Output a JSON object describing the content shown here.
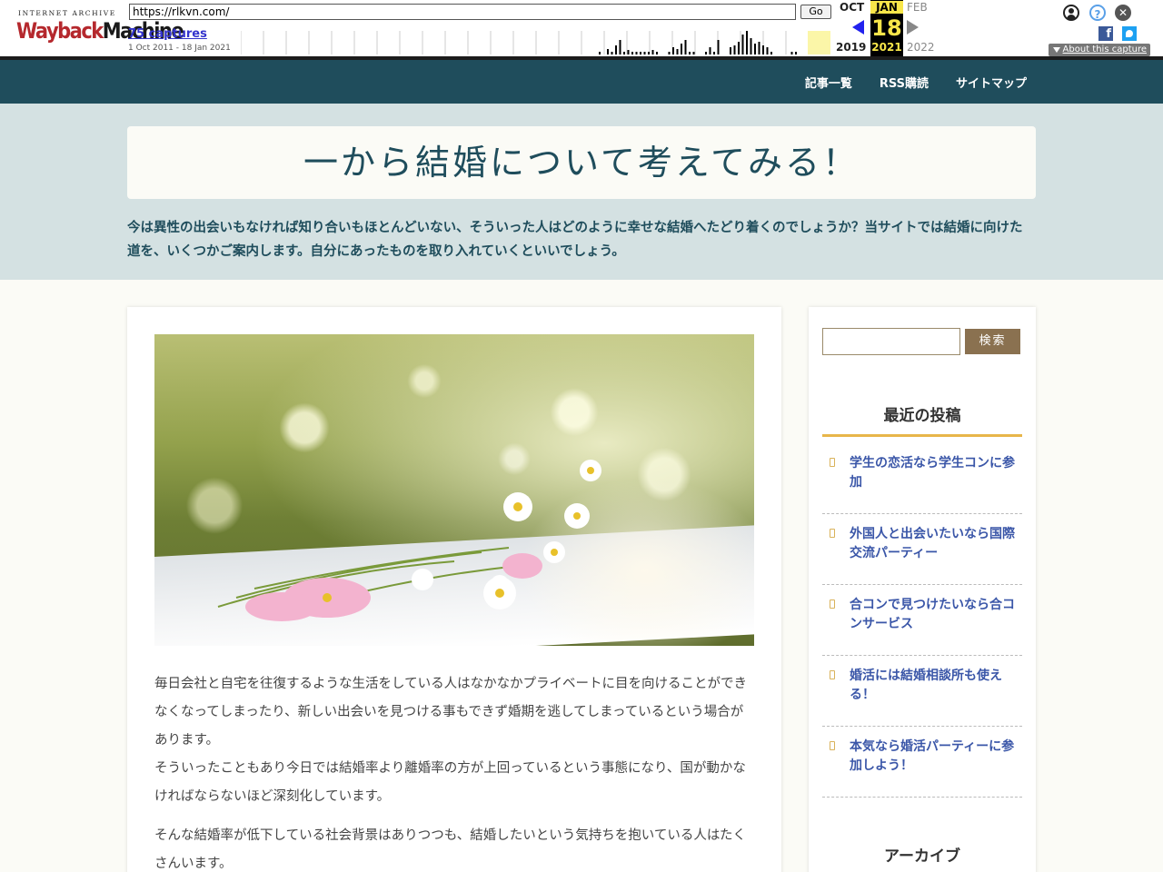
{
  "wayback": {
    "logo_top": "INTERNET ARCHIVE",
    "logo_main_a": "Wayback",
    "logo_main_b": "Machine",
    "url": "https://rlkvn.com/",
    "go_label": "Go",
    "captures": "75 captures",
    "range": "1 Oct 2011 - 18 Jan 2021",
    "prev_month": "OCT",
    "prev_year": "2019",
    "cur_month": "JAN",
    "cur_day": "18",
    "cur_year": "2021",
    "next_month": "FEB",
    "next_year": "2022",
    "about": "About this capture",
    "icons": [
      "user-icon",
      "help-icon",
      "close-icon",
      "facebook-icon",
      "twitter-icon"
    ],
    "capture_heights": [
      3,
      0,
      6,
      3,
      10,
      16,
      3,
      5,
      3,
      3,
      3,
      3,
      3,
      5,
      3,
      0,
      0,
      3,
      8,
      6,
      12,
      16,
      3,
      3,
      0,
      0,
      3,
      8,
      3,
      16,
      0,
      0,
      8,
      10,
      14,
      22,
      26,
      18,
      12,
      14,
      10,
      8,
      3,
      0,
      0,
      0,
      0,
      3,
      3
    ]
  },
  "nav": {
    "items": [
      "記事一覧",
      "RSS購読",
      "サイトマップ"
    ]
  },
  "header": {
    "title": "一から結婚について考えてみる！",
    "tagline": "今は異性の出会いもなければ知り合いもほとんどいない、そういった人はどのように幸せな結婚へたどり着くのでしょうか？当サイトでは結婚に向けた道を、いくつかご案内します。自分にあったものを取り入れていくといいでしょう。"
  },
  "article": {
    "paragraphs": [
      "毎日会社と自宅を往復するような生活をしている人はなかなかプライベートに目を向けることができなくなってしまったり、新しい出会いを見つける事もできず婚期を逃してしまっているという場合があります。",
      "そういったこともあり今日では結婚率より離婚率の方が上回っているという事態になり、国が動かなければならないほど深刻化しています。",
      "そんな結婚率が低下している社会背景はありつつも、結婚したいという気持ちを抱いている人はたくさんいます。"
    ]
  },
  "sidebar": {
    "search_button": "検索",
    "search_value": "",
    "recent_title": "最近の投稿",
    "posts": [
      "学生の恋活なら学生コンに参加",
      "外国人と出会いたいなら国際交流パーティー",
      "合コンで見つけたいなら合コンサービス",
      "婚活には結婚相談所も使える！",
      "本気なら婚活パーティーに参加しよう！"
    ],
    "archive_title": "アーカイブ"
  },
  "colors": {
    "nav_bg": "#1f4d5c",
    "hero_bg": "#d4e1e2",
    "accent": "#e8b64a",
    "button": "#8a7150",
    "link": "#3a56a8"
  }
}
